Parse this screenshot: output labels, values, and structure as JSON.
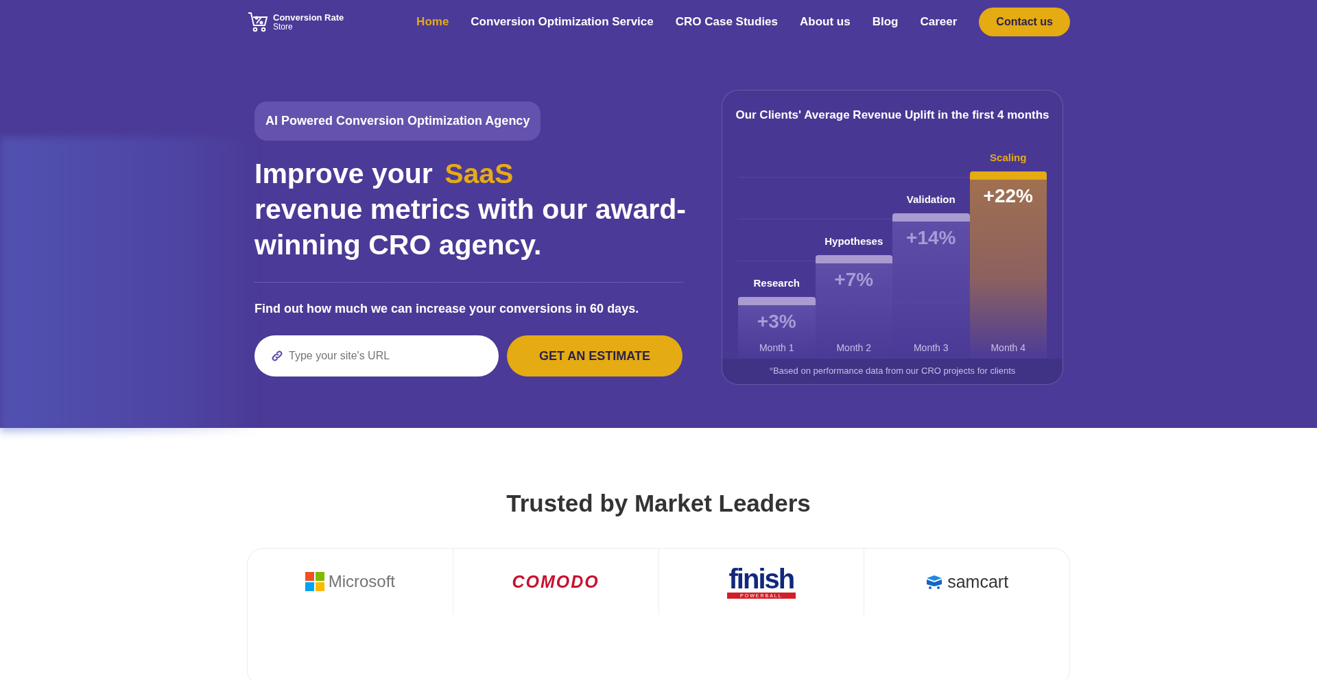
{
  "header": {
    "logo": {
      "name": "Conversion Rate",
      "sub": "Store"
    },
    "nav": [
      {
        "label": "Home",
        "selected": true
      },
      {
        "label": "Conversion Optimization Service",
        "selected": false
      },
      {
        "label": "CRO Case Studies",
        "selected": false
      },
      {
        "label": "About us",
        "selected": false
      },
      {
        "label": "Blog",
        "selected": false
      },
      {
        "label": "Career",
        "selected": false
      }
    ],
    "cta": "Contact us"
  },
  "hero": {
    "tag": "AI Powered Conversion Optimization Agency",
    "heading": {
      "before": "Improve your",
      "highlight": "SaaS",
      "after": "revenue metrics with our award-winning CRO agency."
    },
    "subtitle": "Find out how much we can increase your conversions in 60 days.",
    "url_field": {
      "placeholder": "Type your site's URL"
    },
    "button": "GET AN ESTIMATE"
  },
  "chart": {
    "title": "Our Clients' Average Revenue Uplift in the first 4 months",
    "steps": [
      {
        "stage": "Research",
        "value": "+3%",
        "month": "Month 1",
        "highlighted": false
      },
      {
        "stage": "Hypotheses",
        "value": "+7%",
        "month": "Month 2",
        "highlighted": false
      },
      {
        "stage": "Validation",
        "value": "+14%",
        "month": "Month 3",
        "highlighted": false
      },
      {
        "stage": "Scaling",
        "value": "+22%",
        "month": "Month 4",
        "highlighted": true
      }
    ],
    "footnote": "°Based on performance data from our CRO projects for clients"
  },
  "trusted": {
    "title": "Trusted by Market Leaders",
    "logos": [
      {
        "kind": "microsoft",
        "text": "Microsoft"
      },
      {
        "kind": "comodo",
        "text": "COMODO"
      },
      {
        "kind": "finish",
        "text": "finish",
        "sub": "POWERBALL"
      },
      {
        "kind": "samcart",
        "text": "samcart"
      }
    ]
  }
}
